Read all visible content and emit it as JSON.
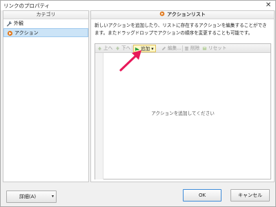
{
  "window": {
    "title": "リンクのプロパティ",
    "close_glyph": "✕"
  },
  "left_panel": {
    "header": "カテゴリ",
    "items": [
      {
        "label": "外観",
        "icon": "wrench-icon",
        "selected": false
      },
      {
        "label": "アクション",
        "icon": "action-icon",
        "selected": true
      }
    ]
  },
  "right_panel": {
    "header": "アクションリスト",
    "description": "新しいアクションを追加したり、リストに存在するアクションを編集することができます。またドラッグドロップでアクションの順序を変更することも可能です。",
    "toolbar": {
      "up": "上へ",
      "down": "下へ",
      "add": "追加",
      "add_caret": "▾",
      "edit": "編集...",
      "delete": "削除",
      "reset": "リセット"
    },
    "empty_message": "アクションを追加してください"
  },
  "buttons": {
    "detail": "詳細(A)",
    "detail_caret": "▾",
    "ok": "OK",
    "cancel": "キャンセル"
  },
  "colors": {
    "accent_arrow": "#e8195a",
    "selection": "#cce4f7",
    "add_highlight": "#fff8c8"
  }
}
